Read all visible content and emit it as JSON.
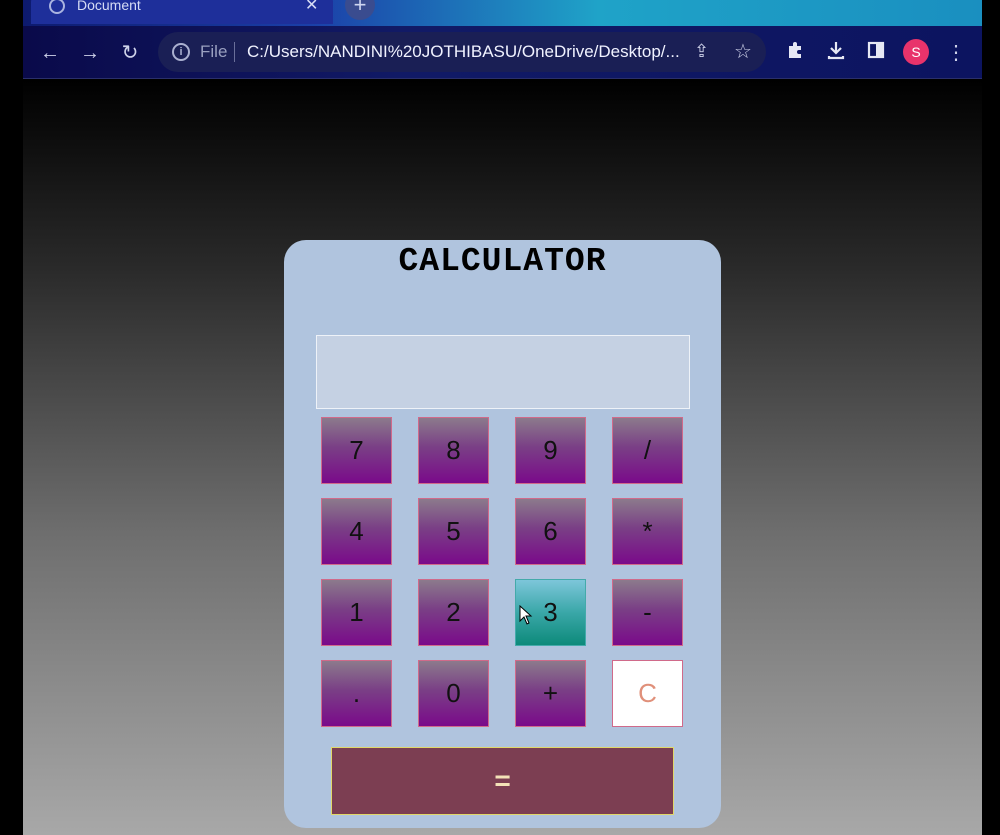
{
  "browser": {
    "tab_title": "Document",
    "omnibox": {
      "scheme_label": "File",
      "url": "C:/Users/NANDINI%20JOTHIBASU/OneDrive/Desktop/..."
    },
    "profile_initial": "S",
    "colors": {
      "profile": "#e8336b"
    }
  },
  "calculator": {
    "title": "CALCULATOR",
    "display_value": "",
    "keys": [
      {
        "label": "7"
      },
      {
        "label": "8"
      },
      {
        "label": "9"
      },
      {
        "label": "/"
      },
      {
        "label": "4"
      },
      {
        "label": "5"
      },
      {
        "label": "6"
      },
      {
        "label": "*"
      },
      {
        "label": "1"
      },
      {
        "label": "2"
      },
      {
        "label": "3"
      },
      {
        "label": "-"
      },
      {
        "label": "."
      },
      {
        "label": "0"
      },
      {
        "label": "+"
      },
      {
        "label": "C"
      }
    ],
    "equals_label": "=",
    "hovered_key": "3",
    "colors": {
      "body": "#b0c4de",
      "key": "#7a0a8a",
      "key_hover": "#0d8a7a",
      "equals": "#7c3e52",
      "clear_text": "#e0907a"
    }
  }
}
